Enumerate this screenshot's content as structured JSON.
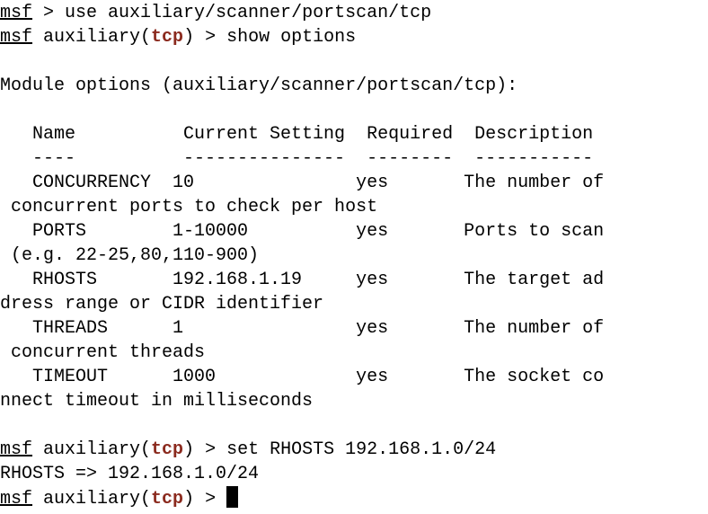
{
  "terminal": {
    "prompt_label": "msf",
    "line1_cmd": " > use auxiliary/scanner/portscan/tcp",
    "ctx_prefix": " auxiliary(",
    "ctx_module": "tcp",
    "ctx_suffix": ") > ",
    "line2_cmd": "show options",
    "line4": "Module options (auxiliary/scanner/portscan/tcp):",
    "header": "   Name          Current Setting  Required  Description",
    "separator": "   ----          ---------------  --------  -----------",
    "options": [
      {
        "row": "   CONCURRENCY  10               yes       The number of",
        "wrap": " concurrent ports to check per host"
      },
      {
        "row": "   PORTS        1-10000          yes       Ports to scan",
        "wrap": " (e.g. 22-25,80,110-900)"
      },
      {
        "row": "   RHOSTS       192.168.1.19     yes       The target ad",
        "wrap": "dress range or CIDR identifier"
      },
      {
        "row": "   THREADS      1                yes       The number of",
        "wrap": " concurrent threads"
      },
      {
        "row": "   TIMEOUT      1000             yes       The socket co",
        "wrap": "nnect timeout in milliseconds"
      }
    ],
    "line_set_cmd": "set RHOSTS 192.168.1.0/24",
    "line_set_result": "RHOSTS => 192.168.1.0/24",
    "colors": {
      "module": "#8b2a1e",
      "text": "#000000",
      "background": "#ffffff"
    }
  }
}
